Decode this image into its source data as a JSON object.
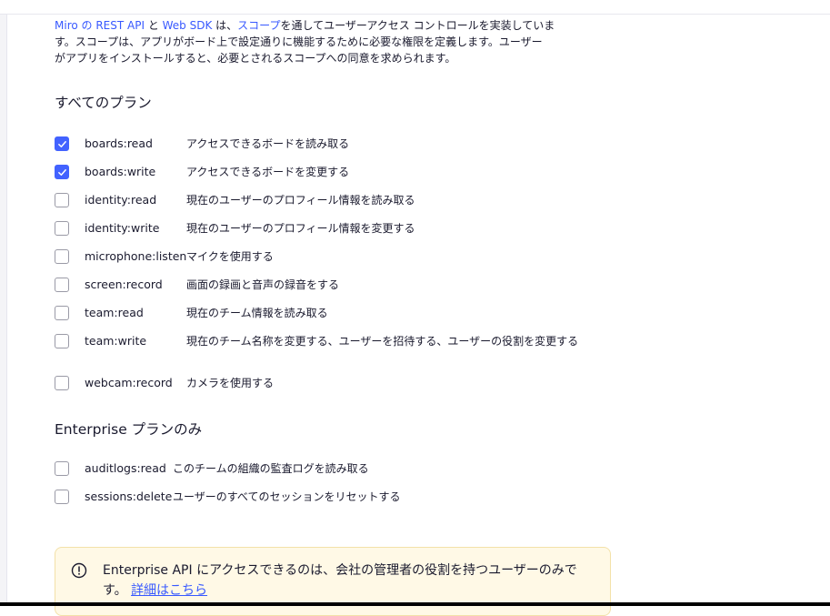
{
  "intro": {
    "p1_link1": "Miro の REST API",
    "p1_text1": " と ",
    "p1_link2": "Web SDK",
    "p1_text2": " は、",
    "p1_link3": "スコープ",
    "p1_text3": "を通してユーザーアクセス コントロールを実装していま",
    "line2": "す。スコープは、アプリがボード上で設定通りに機能するために必要な権限を定義します。ユーザー",
    "line3": "がアプリをインストールすると、必要とされるスコープへの同意を求められます。"
  },
  "sections": {
    "all_plans": {
      "title": "すべてのプラン",
      "scopes": [
        {
          "name": "boards:read",
          "desc": "アクセスできるボードを読み取る",
          "checked": true
        },
        {
          "name": "boards:write",
          "desc": "アクセスできるボードを変更する",
          "checked": true
        },
        {
          "name": "identity:read",
          "desc": "現在のユーザーのプロフィール情報を読み取る",
          "checked": false
        },
        {
          "name": "identity:write",
          "desc": "現在のユーザーのプロフィール情報を変更する",
          "checked": false
        },
        {
          "name": "microphone:listen",
          "desc": "マイクを使用する",
          "checked": false
        },
        {
          "name": "screen:record",
          "desc": "画面の録画と音声の録音をする",
          "checked": false
        },
        {
          "name": "team:read",
          "desc": "現在のチーム情報を読み取る",
          "checked": false
        },
        {
          "name": "team:write",
          "desc": "現在のチーム名称を変更する、ユーザーを招待する、ユーザーの役割を変更する",
          "checked": false
        },
        {
          "name": "webcam:record",
          "desc": "カメラを使用する",
          "checked": false
        }
      ]
    },
    "enterprise": {
      "title": "Enterprise プランのみ",
      "scopes": [
        {
          "name": "auditlogs:read",
          "desc": "このチームの組織の監査ログを読み取る",
          "checked": false
        },
        {
          "name": "sessions:delete",
          "desc": "ユーザーのすべてのセッションをリセットする",
          "checked": false
        }
      ]
    }
  },
  "notice": {
    "icon": "info-circle-icon",
    "text": "Enterprise API にアクセスできるのは、会社の管理者の役割を持つユーザーのみです。",
    "link": "詳細はこちら"
  },
  "colors": {
    "accent": "#4262ff",
    "link": "#3859ff",
    "notice_bg": "#fff9e6"
  }
}
